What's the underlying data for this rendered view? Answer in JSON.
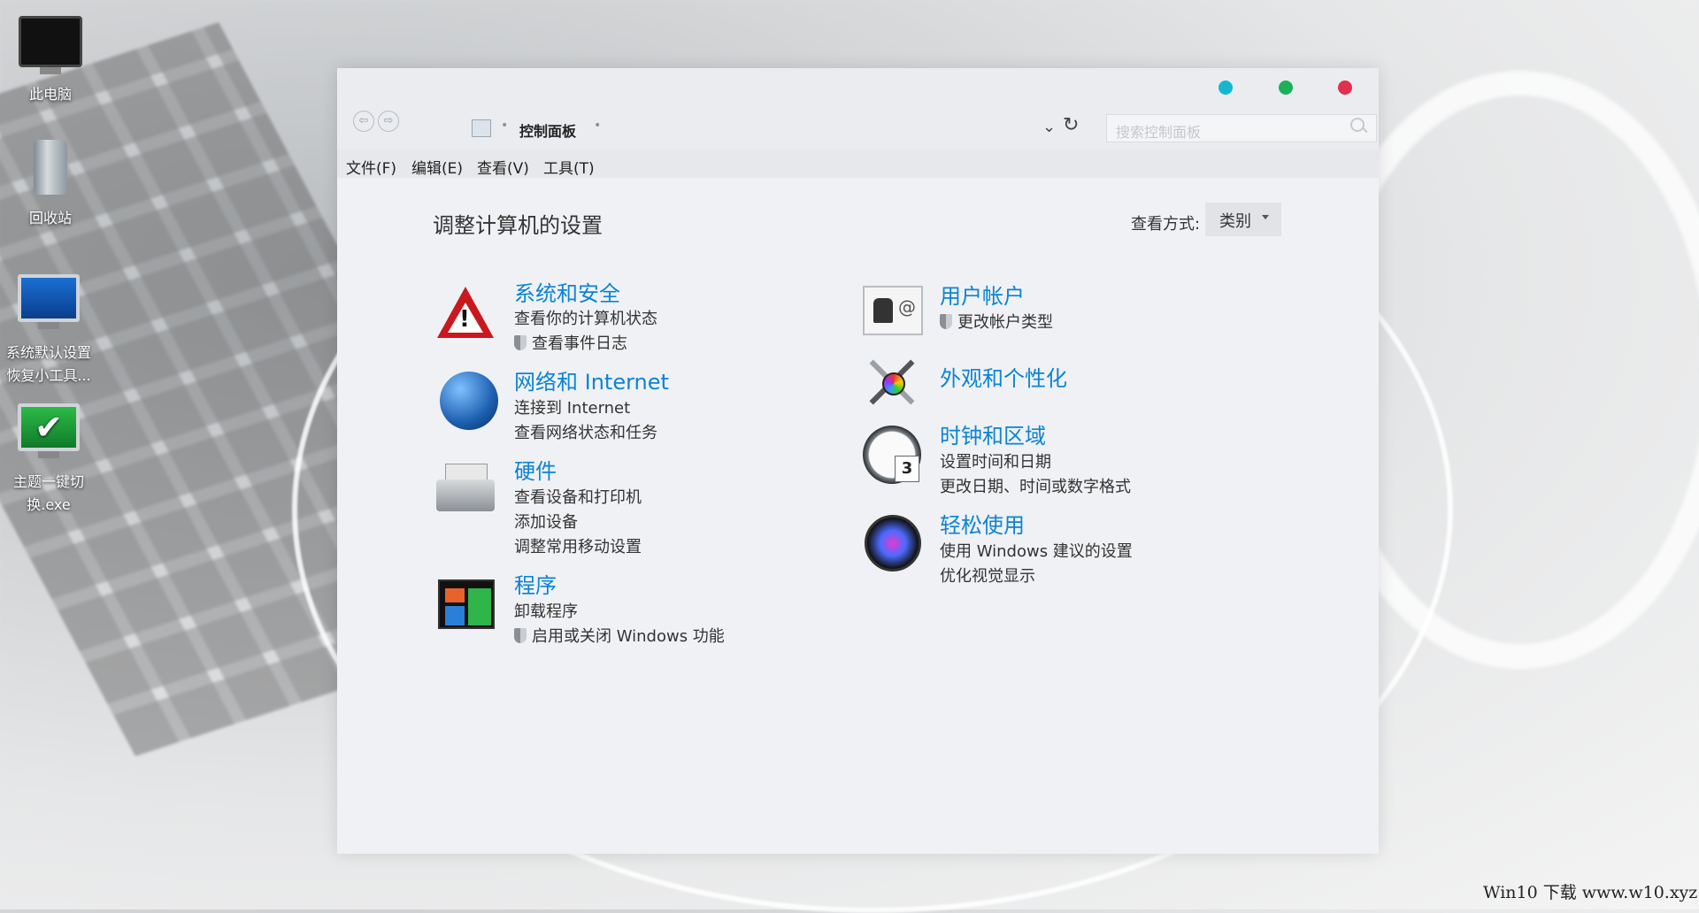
{
  "desktop": {
    "icons": [
      {
        "label": "此电脑"
      },
      {
        "label": "回收站"
      },
      {
        "label_line1": "系统默认设置",
        "label_line2": "恢复小工具..."
      },
      {
        "label_line1": "主题一键切",
        "label_line2": "换.exe"
      }
    ],
    "watermark": "Win10 下载 www.w10.xyz"
  },
  "window": {
    "controls": {
      "colors": [
        "#13b8cf",
        "#1bb15a",
        "#e0304e"
      ]
    },
    "nav": {
      "back_icon": "back-arrow-icon",
      "forward_icon": "forward-arrow-icon",
      "breadcrumb": "控制面板",
      "dropdown_icon": "chevron-down-icon",
      "refresh_icon": "refresh-icon"
    },
    "search": {
      "placeholder": "搜索控制面板"
    },
    "menu": [
      "文件(F)",
      "编辑(E)",
      "查看(V)",
      "工具(T)"
    ],
    "page_title": "调整计算机的设置",
    "view_by": {
      "label": "查看方式:",
      "value": "类别"
    },
    "categories_left": [
      {
        "title": "系统和安全",
        "icon": "warning-icon",
        "links": [
          "查看你的计算机状态",
          "查看事件日志"
        ]
      },
      {
        "title": "网络和 Internet",
        "icon": "globe-icon",
        "links": [
          "连接到 Internet",
          "查看网络状态和任务"
        ]
      },
      {
        "title": "硬件",
        "icon": "printer-icon",
        "links": [
          "查看设备和打印机",
          "添加设备",
          "调整常用移动设置"
        ]
      },
      {
        "title": "程序",
        "icon": "programs-icon",
        "links": [
          "卸载程序",
          "启用或关闭 Windows 功能"
        ]
      }
    ],
    "categories_right": [
      {
        "title": "用户帐户",
        "icon": "user-accounts-icon",
        "links": [
          "更改帐户类型"
        ]
      },
      {
        "title": "外观和个性化",
        "icon": "tools-palette-icon",
        "links": []
      },
      {
        "title": "时钟和区域",
        "icon": "clock-icon",
        "links": [
          "设置时间和日期",
          "更改日期、时间或数字格式"
        ]
      },
      {
        "title": "轻松使用",
        "icon": "siri-icon",
        "links": [
          "使用 Windows 建议的设置",
          "优化视觉显示"
        ]
      }
    ],
    "link_color": "#0a84d6"
  }
}
